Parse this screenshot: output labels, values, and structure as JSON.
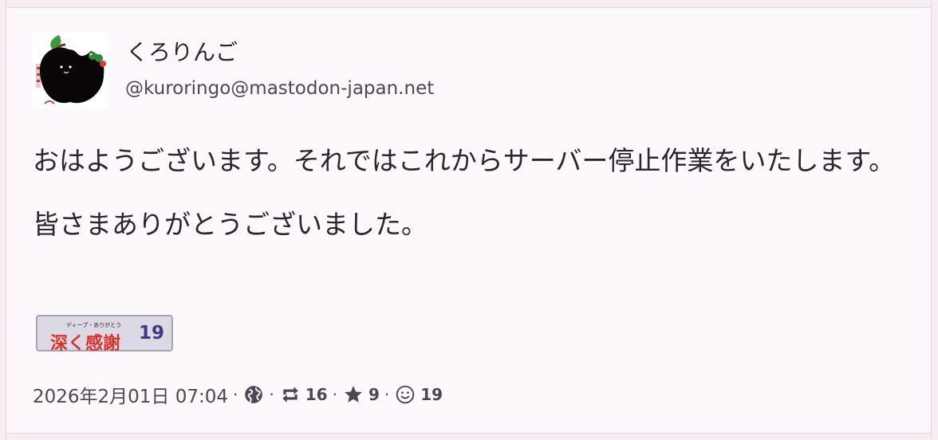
{
  "status": {
    "account": {
      "display_name": "くろりんご",
      "acct": "@kuroringo@mastodon-japan.net",
      "avatar_icon": "black-apple-avatar"
    },
    "content": {
      "paragraphs": [
        "おはようございます。それではこれからサーバー停止作業をいたします。",
        "皆さまありがとうございました。"
      ]
    },
    "reaction": {
      "ruby": "ディープ・ありがとう",
      "label": "深く感謝",
      "count": "19"
    },
    "meta": {
      "datetime": "2026年2月01日 07:04",
      "visibility_icon": "globe-icon",
      "boosts_icon": "boost-icon",
      "boosts": "16",
      "favourites_icon": "star-icon",
      "favourites": "9",
      "reactions_icon": "smile-icon",
      "reactions": "19"
    },
    "colors": {
      "background": "#fcf8fb",
      "reaction_text": "#d8322b",
      "reaction_count": "#3d3a8c",
      "reaction_bg": "#dcd9e4"
    }
  }
}
